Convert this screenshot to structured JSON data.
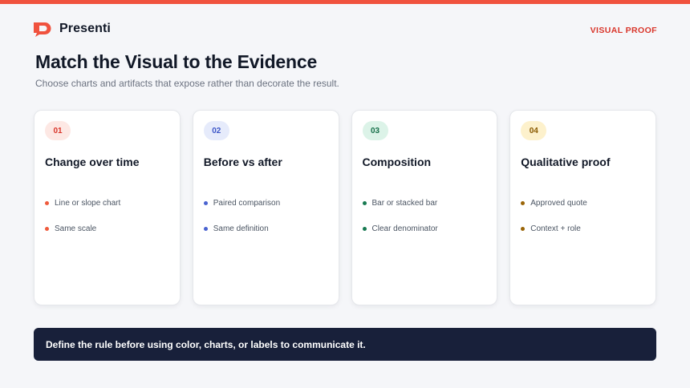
{
  "header": {
    "brand": "Presenti",
    "tag": "VISUAL PROOF",
    "colors": {
      "accent": "#f0523e",
      "tag": "#d9352a"
    }
  },
  "main": {
    "title": "Match the Visual to the Evidence",
    "subtitle": "Choose charts and artifacts that expose rather than decorate the result."
  },
  "cards": [
    {
      "number": "01",
      "title": "Change over time",
      "bullets": [
        "Line or slope chart",
        "Same scale"
      ],
      "colors": {
        "badge_bg": "#fde8e4",
        "badge_text": "#d9352a",
        "dot": "#ef5a3c"
      }
    },
    {
      "number": "02",
      "title": "Before vs after",
      "bullets": [
        "Paired comparison",
        "Same definition"
      ],
      "colors": {
        "badge_bg": "#e6ebfb",
        "badge_text": "#3d56c7",
        "dot": "#4a63d0"
      }
    },
    {
      "number": "03",
      "title": "Composition",
      "bullets": [
        "Bar or stacked bar",
        "Clear denominator"
      ],
      "colors": {
        "badge_bg": "#dcf3e8",
        "badge_text": "#17704a",
        "dot": "#187a52"
      }
    },
    {
      "number": "04",
      "title": "Qualitative proof",
      "bullets": [
        "Approved quote",
        "Context + role"
      ],
      "colors": {
        "badge_bg": "#fdf1cc",
        "badge_text": "#8a5a00",
        "dot": "#9a6508"
      }
    }
  ],
  "footer": {
    "text": "Define the rule before using color, charts, or labels to communicate it.",
    "colors": {
      "background": "#18203a",
      "text": "#ffffff"
    }
  }
}
